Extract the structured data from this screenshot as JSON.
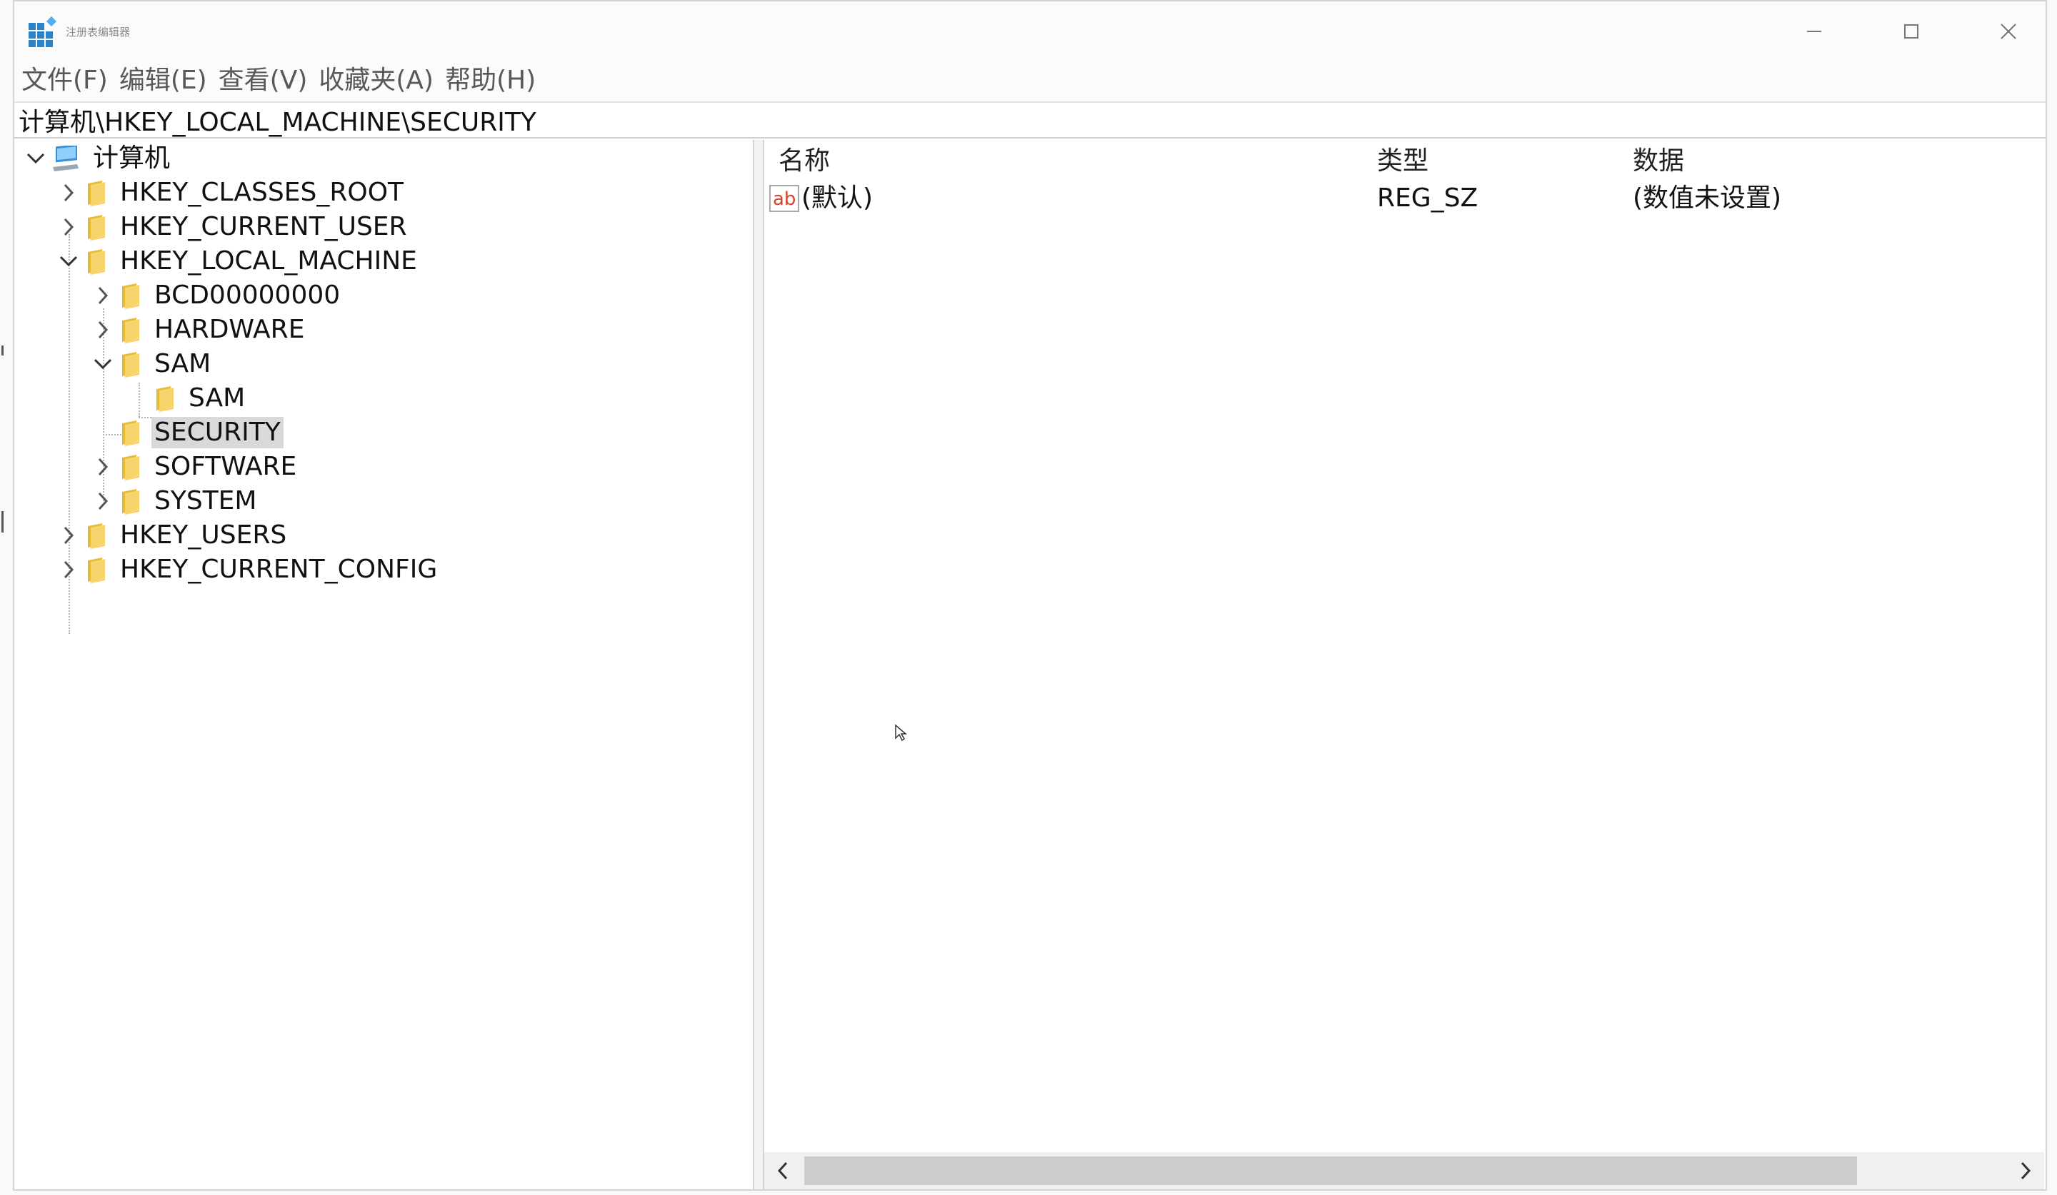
{
  "window": {
    "title": "注册表编辑器"
  },
  "menu": {
    "items": [
      "文件(F)",
      "编辑(E)",
      "查看(V)",
      "收藏夹(A)",
      "帮助(H)"
    ]
  },
  "address": {
    "value": "计算机\\HKEY_LOCAL_MACHINE\\SECURITY"
  },
  "tree": {
    "root": "计算机",
    "hives": [
      "HKEY_CLASSES_ROOT",
      "HKEY_CURRENT_USER",
      "HKEY_LOCAL_MACHINE",
      "HKEY_USERS",
      "HKEY_CURRENT_CONFIG"
    ],
    "hklm_children": [
      "BCD00000000",
      "HARDWARE",
      "SAM",
      "SECURITY",
      "SOFTWARE",
      "SYSTEM"
    ],
    "sam_children": [
      "SAM"
    ],
    "selected": "SECURITY"
  },
  "values": {
    "columns": [
      "名称",
      "类型",
      "数据"
    ],
    "rows": [
      {
        "name": "(默认)",
        "type": "REG_SZ",
        "data": "(数值未设置)",
        "icon": "string-value-icon"
      }
    ]
  },
  "colors": {
    "folder": "#f0c44c",
    "selection": "#d9d9d9",
    "value_icon": "#d9432c"
  }
}
